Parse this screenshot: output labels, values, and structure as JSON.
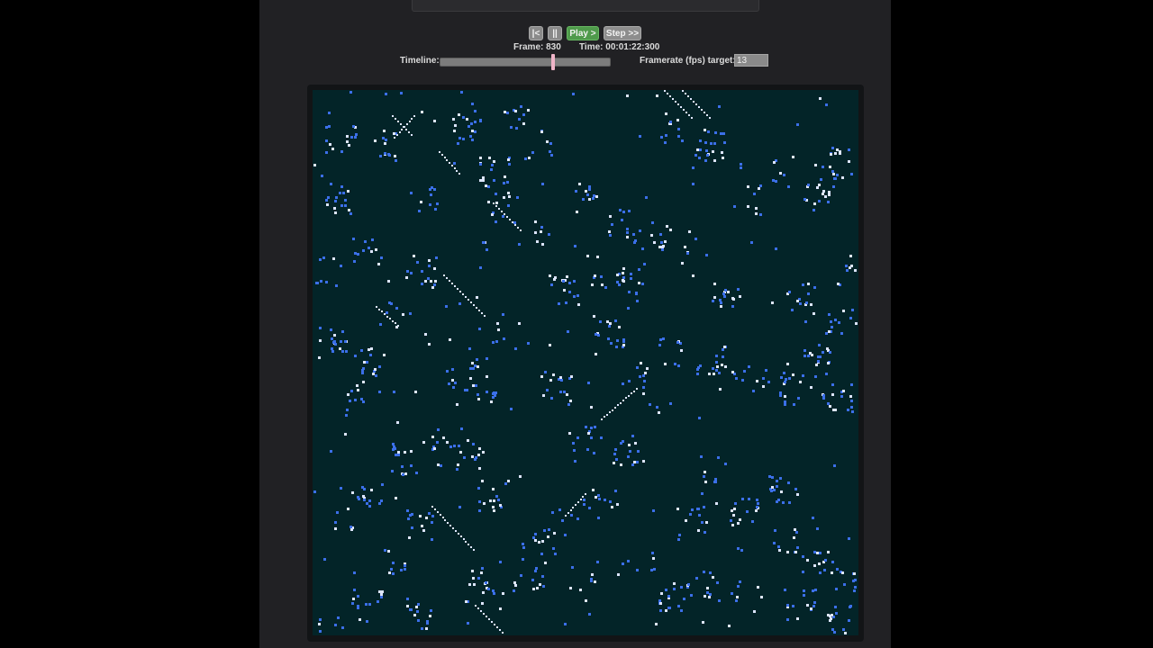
{
  "controls": {
    "first_label": "|<",
    "pause_label": "||",
    "play_label": "Play >",
    "step_label": "Step >>"
  },
  "status": {
    "frame_text": "Frame: 830",
    "time_text": "Time: 00:01:22:300"
  },
  "timeline": {
    "label": "Timeline:",
    "position": 0.66
  },
  "framerate": {
    "label": "Framerate (fps) target:",
    "value": "13"
  },
  "simulation": {
    "background_color": "#032428",
    "cell_color": "#3b6fe8",
    "cell_highlight": "#dde6ff"
  }
}
